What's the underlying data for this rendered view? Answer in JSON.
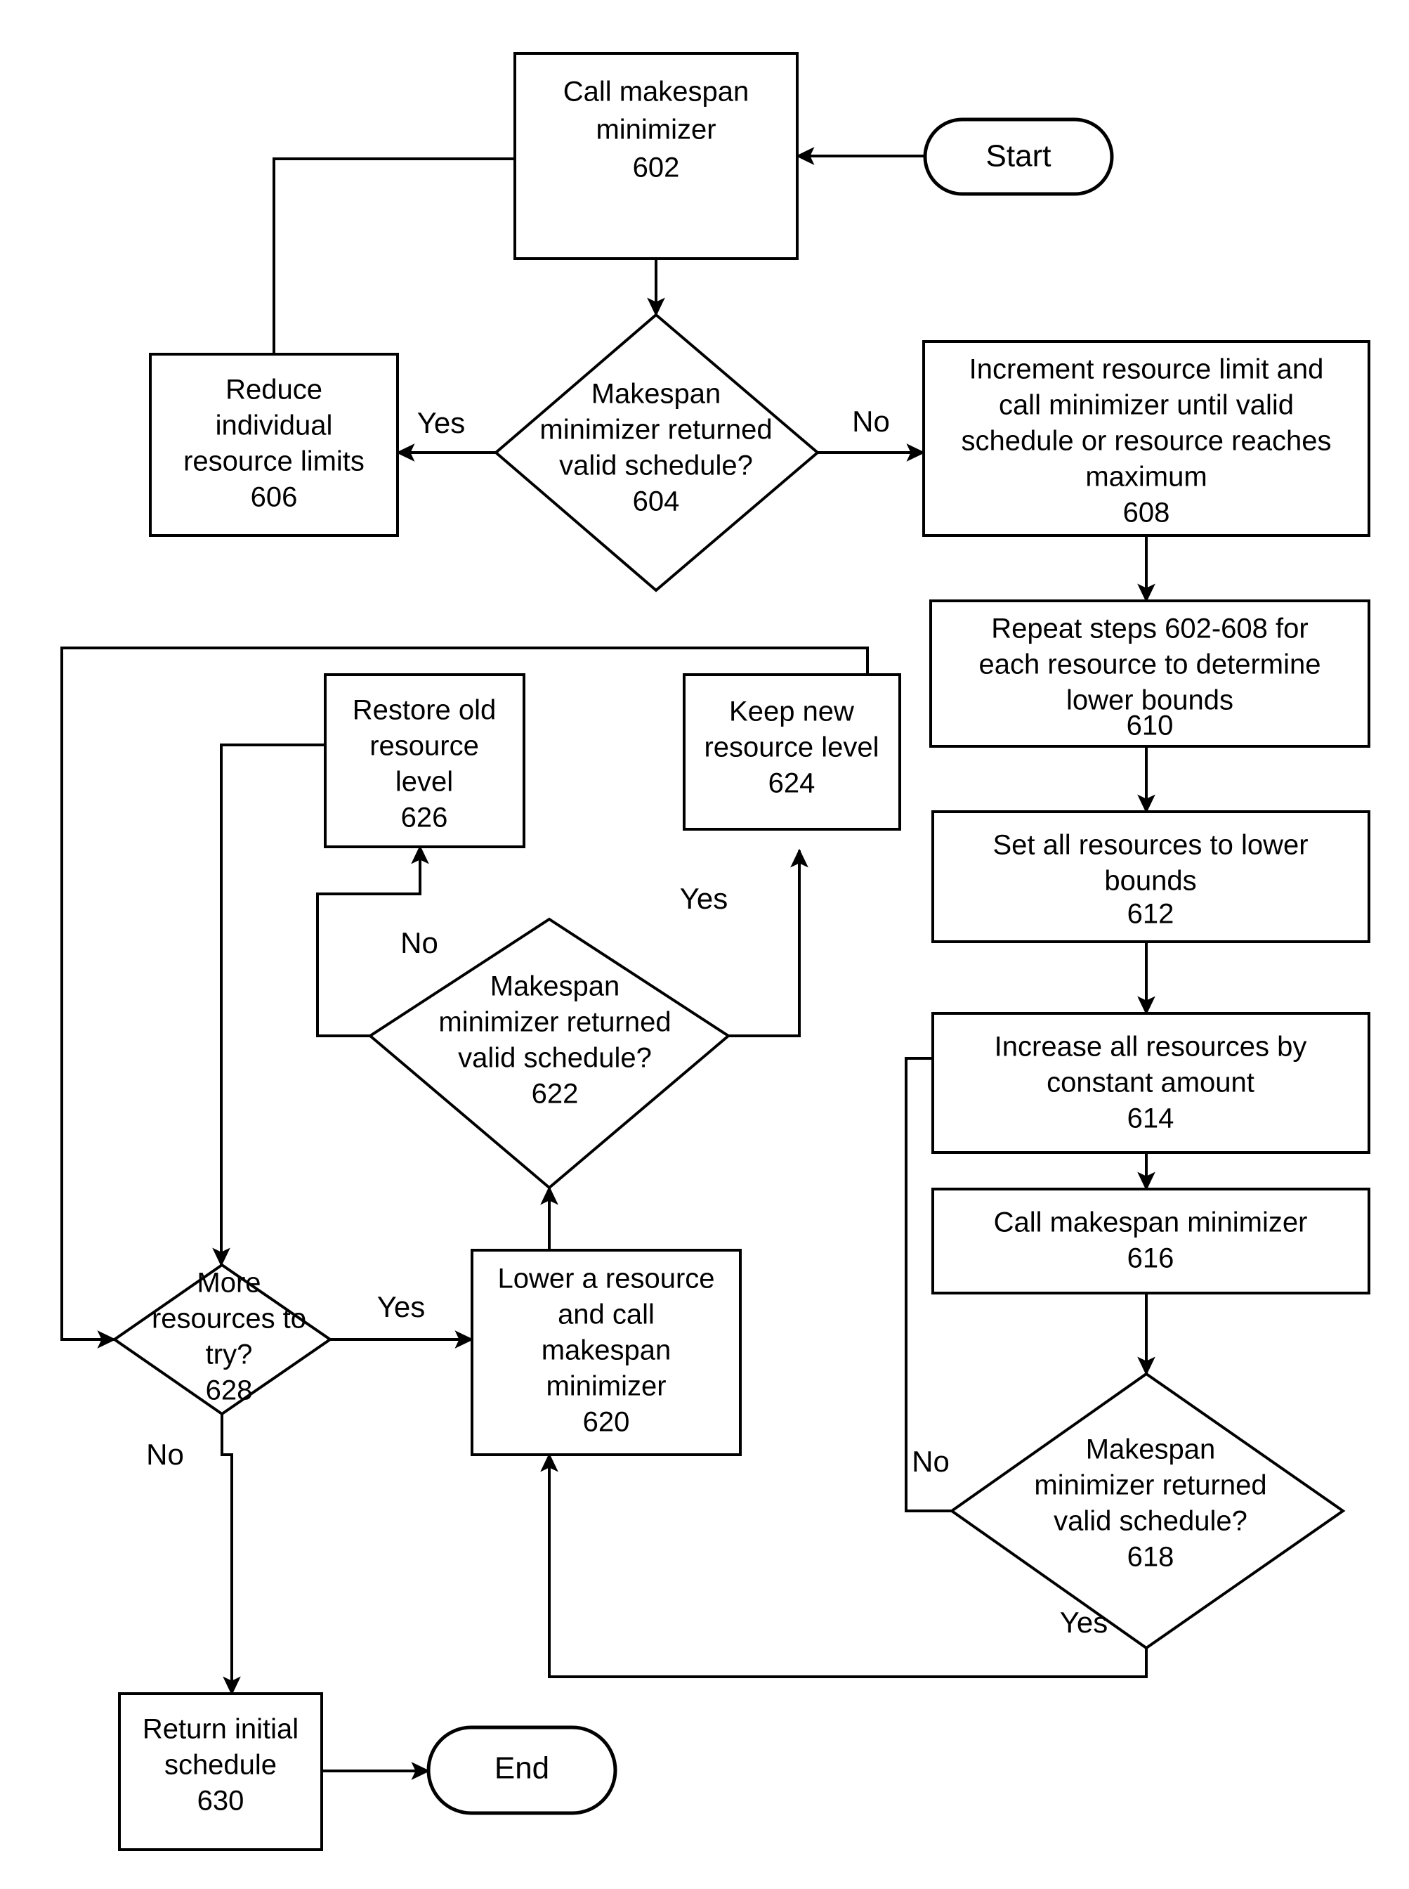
{
  "diagram": {
    "type": "flowchart",
    "title": "",
    "terminators": {
      "start": "Start",
      "end": "End"
    },
    "nodes": {
      "n602": {
        "id": "602",
        "lines": [
          "Call makespan",
          "minimizer",
          "602"
        ],
        "shape": "process"
      },
      "n604": {
        "id": "604",
        "lines": [
          "Makespan",
          "minimizer returned",
          "valid schedule?",
          "604"
        ],
        "shape": "decision"
      },
      "n606": {
        "id": "606",
        "lines": [
          "Reduce",
          "individual",
          "resource limits",
          "606"
        ],
        "shape": "process"
      },
      "n608": {
        "id": "608",
        "lines": [
          "Increment resource limit and",
          "call minimizer until valid",
          "schedule or resource reaches",
          "maximum",
          "608"
        ],
        "shape": "process"
      },
      "n610": {
        "id": "610",
        "lines": [
          "Repeat steps 602-608 for",
          "each resource to determine",
          "lower bounds",
          "610"
        ],
        "shape": "process"
      },
      "n612": {
        "id": "612",
        "lines": [
          "Set all resources to lower",
          "bounds",
          "612"
        ],
        "shape": "process"
      },
      "n614": {
        "id": "614",
        "lines": [
          "Increase all resources by",
          "constant amount",
          "614"
        ],
        "shape": "process"
      },
      "n616": {
        "id": "616",
        "lines": [
          "Call makespan minimizer",
          "616"
        ],
        "shape": "process"
      },
      "n618": {
        "id": "618",
        "lines": [
          "Makespan",
          "minimizer returned",
          "valid schedule?",
          "618"
        ],
        "shape": "decision"
      },
      "n620": {
        "id": "620",
        "lines": [
          "Lower a resource",
          "and call",
          "makespan",
          "minimizer",
          "620"
        ],
        "shape": "process"
      },
      "n622": {
        "id": "622",
        "lines": [
          "Makespan",
          "minimizer returned",
          "valid schedule?",
          "622"
        ],
        "shape": "decision"
      },
      "n624": {
        "id": "624",
        "lines": [
          "Keep new",
          "resource level",
          "624"
        ],
        "shape": "process"
      },
      "n626": {
        "id": "626",
        "lines": [
          "Restore old",
          "resource",
          "level",
          "626"
        ],
        "shape": "process"
      },
      "n628": {
        "id": "628",
        "lines": [
          "More",
          "resources to",
          "try?",
          "628"
        ],
        "shape": "decision"
      },
      "n630": {
        "id": "630",
        "lines": [
          "Return initial",
          "schedule",
          "630"
        ],
        "shape": "process"
      }
    },
    "edge_labels": {
      "e604_yes": "Yes",
      "e604_no": "No",
      "e618_no": "No",
      "e618_yes": "Yes",
      "e622_no": "No",
      "e622_yes": "Yes",
      "e628_yes": "Yes",
      "e628_no": "No"
    },
    "colors": {
      "stroke": "#000000",
      "fill": "#ffffff",
      "text": "#000000"
    }
  }
}
